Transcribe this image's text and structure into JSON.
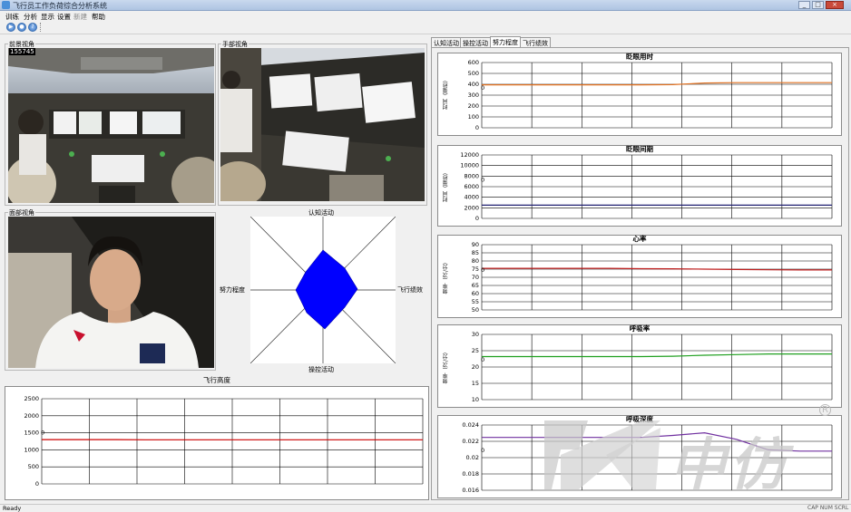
{
  "window": {
    "title": "飞行员工作负荷综合分析系统",
    "min": "_",
    "max": "□",
    "close": "×"
  },
  "menu": [
    "训练",
    "分析",
    "显示",
    "设置",
    "新建",
    "帮助"
  ],
  "toolbar": {
    "icons": [
      "play-icon",
      "record-icon",
      "help-icon"
    ]
  },
  "views": {
    "front_label": "前景视角",
    "hand_label": "手部视角",
    "face_label": "面部视角",
    "frame_counter": "155745"
  },
  "radar": {
    "top": "认知活动",
    "right": "飞行绩效",
    "bottom": "操控活动",
    "left": "努力程度",
    "color": "#0000ff"
  },
  "altitude": {
    "title": "飞行高度",
    "zero_marker": "0",
    "color": "#cc0000",
    "chart_data": {
      "type": "line",
      "yticks": [
        "2500",
        "2000",
        "1500",
        "1000",
        "500",
        "0"
      ],
      "ylim": [
        0,
        2500
      ],
      "series": [
        {
          "values": [
            1300,
            1300,
            1300,
            1295,
            1295,
            1295,
            1295,
            1295,
            1295,
            1295,
            1295,
            1295
          ]
        }
      ]
    }
  },
  "tabs": [
    "认知活动",
    "操控活动",
    "努力程度",
    "飞行绩效"
  ],
  "active_tab": 2,
  "charts": [
    {
      "title": "眨眼用时",
      "ylabel": "时间（毫秒）",
      "zero_marker": "0",
      "color": "#e07020",
      "chart_data": {
        "type": "line",
        "yticks": [
          "600",
          "500",
          "400",
          "300",
          "200",
          "100",
          "0"
        ],
        "ylim": [
          0,
          600
        ],
        "series": [
          {
            "values": [
              395,
              395,
              395,
              395,
              395,
              395,
              397,
              412,
              415,
              415,
              415,
              415
            ]
          }
        ]
      }
    },
    {
      "title": "眨眼间期",
      "ylabel": "时间（毫秒）",
      "zero_marker": "0",
      "color": "#202070",
      "chart_data": {
        "type": "line",
        "yticks": [
          "12000",
          "10000",
          "8000",
          "6000",
          "4000",
          "2000",
          "0"
        ],
        "ylim": [
          0,
          12000
        ],
        "series": [
          {
            "values": [
              2500,
              2500,
              2500,
              2500,
              2500,
              2500,
              2500,
              2500,
              2500,
              2500,
              2500,
              2500
            ]
          }
        ]
      }
    },
    {
      "title": "心率",
      "ylabel": "频率（次/分）",
      "zero_marker": "0",
      "color": "#c02020",
      "chart_data": {
        "type": "line",
        "yticks": [
          "90",
          "85",
          "80",
          "75",
          "70",
          "65",
          "60",
          "55",
          "50"
        ],
        "ylim": [
          50,
          90
        ],
        "series": [
          {
            "values": [
              75.5,
              75.5,
              75.5,
              75.5,
              75.5,
              75.3,
              75.2,
              75,
              74.8,
              74.6,
              74.5,
              74.5
            ]
          }
        ]
      }
    },
    {
      "title": "呼吸率",
      "ylabel": "频率（次/分）",
      "zero_marker": "0",
      "color": "#20a020",
      "chart_data": {
        "type": "line",
        "yticks": [
          "30",
          "25",
          "20",
          "15",
          "10"
        ],
        "ylim": [
          10,
          30
        ],
        "series": [
          {
            "values": [
              23.2,
              23.2,
              23.2,
              23.2,
              23.2,
              23.2,
              23.3,
              23.6,
              23.8,
              24,
              24,
              24
            ]
          }
        ]
      }
    },
    {
      "title": "呼吸深度",
      "ylabel": "",
      "zero_marker": "0",
      "color": "#7030a0",
      "chart_data": {
        "type": "line",
        "yticks": [
          "0.024",
          "0.022",
          "0.02",
          "0.018",
          "0.016"
        ],
        "ylim": [
          0.015,
          0.025
        ],
        "series": [
          {
            "values": [
              0.0231,
              0.0231,
              0.0231,
              0.0231,
              0.0231,
              0.0231,
              0.0234,
              0.0238,
              0.0228,
              0.0212,
              0.021,
              0.021
            ]
          }
        ]
      }
    }
  ],
  "watermark": {
    "text": "中仿",
    "registered": "R"
  },
  "statusbar": {
    "left": "Ready",
    "right": "CAP  NUM  SCRL"
  }
}
